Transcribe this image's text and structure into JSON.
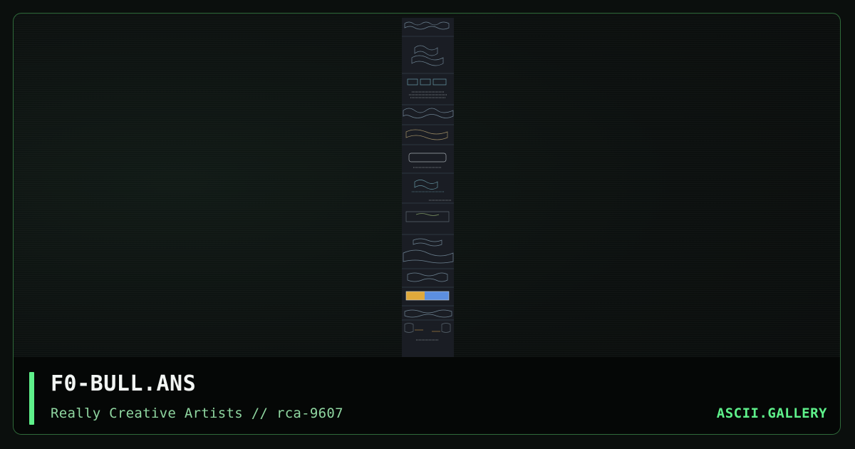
{
  "artwork": {
    "filename": "F0-BULL.ANS",
    "credit": "Really Creative Artists // rca-9607",
    "preview_description": "ascii-art-preview-thumbnail"
  },
  "site": {
    "brand": "ASCII.GALLERY"
  },
  "colors": {
    "accent": "#5ef08a",
    "border": "#2f6b3a",
    "subtitle": "#8fd6a0",
    "background": "#0b0f0d",
    "preview_bg": "#1a1d24"
  }
}
